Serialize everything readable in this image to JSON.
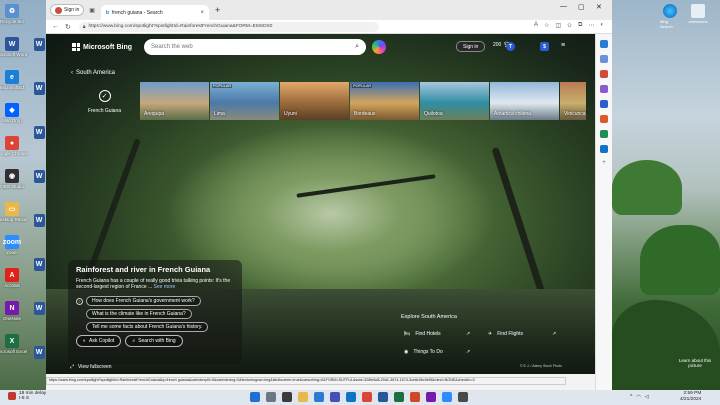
{
  "desktop": {
    "left_icons": [
      {
        "label": "Recycle Bin",
        "icon": "recycle-bin-icon",
        "color": "#5a8fd0",
        "glyph": "♻"
      },
      {
        "label": "Microsoft Word",
        "icon": "word-icon",
        "color": "#2b579a",
        "glyph": "W"
      },
      {
        "label": "MicrosoftEd",
        "icon": "edge-icon",
        "color": "#1b7fd6",
        "glyph": "e"
      },
      {
        "label": "Mac Drop",
        "icon": "dropbox-icon",
        "color": "#0061fe",
        "glyph": "◆"
      },
      {
        "label": "Google Chrome",
        "icon": "chrome-icon",
        "color": "#db4437",
        "glyph": "●"
      },
      {
        "label": "OBS Studio",
        "icon": "obs-icon",
        "color": "#302e31",
        "glyph": "◉"
      },
      {
        "label": "Desktop Recov",
        "icon": "folder-icon",
        "color": "#e8b84a",
        "glyph": "▭"
      },
      {
        "label": "Zoom",
        "icon": "zoom-icon",
        "color": "#2d8cff",
        "glyph": "zoom"
      },
      {
        "label": "Acrobat",
        "icon": "acrobat-icon",
        "color": "#e0231a",
        "glyph": "A"
      },
      {
        "label": "OneNote",
        "icon": "onenote-icon",
        "color": "#7719aa",
        "glyph": "N"
      },
      {
        "label": "Microsoft Excel",
        "icon": "excel-icon",
        "color": "#1d6f42",
        "glyph": "X"
      }
    ],
    "second_col_icons": [
      {
        "label": "",
        "icon": "word-icon",
        "color": "#2b579a",
        "glyph": "W"
      },
      {
        "label": "",
        "icon": "word-icon",
        "color": "#2b579a",
        "glyph": "W"
      },
      {
        "label": "",
        "icon": "word-icon",
        "color": "#2b579a",
        "glyph": "W"
      },
      {
        "label": "",
        "icon": "word-icon",
        "color": "#2b579a",
        "glyph": "W"
      },
      {
        "label": "",
        "icon": "word-icon",
        "color": "#2b579a",
        "glyph": "W"
      },
      {
        "label": "",
        "icon": "word-icon",
        "color": "#2b579a",
        "glyph": "W"
      },
      {
        "label": "",
        "icon": "word-icon",
        "color": "#2b579a",
        "glyph": "W"
      },
      {
        "label": "",
        "icon": "word-icon",
        "color": "#2b579a",
        "glyph": "W"
      }
    ],
    "right_top_icons": [
      {
        "label": "Bing Search",
        "icon": "edge-icon"
      },
      {
        "label": "extensions",
        "icon": "app-icon"
      }
    ],
    "right_note": "Learn about this picture"
  },
  "browser": {
    "profile_label": "Sign in",
    "tab_title": "french guiana - Search",
    "url": "https://www.bing.com/spotlight?spotlightId=RainforestFrenchGuiana&FORM=EMSDS0",
    "status_url": "https://www.bing.com/spotlight?spotlightId=RainforestFrenchGuiana&q=french guiana&carindexpill=0&carindexing=0&textorimgcar=img&isfullscreen=true&carscrlimg=0&FORM=SUTFUL&ssid=328fe6d8-20d1-3674-1574-3ce8c0bc9e5f&mind=NONE&checkfu=0"
  },
  "bing": {
    "brand": "Microsoft Bing",
    "search_placeholder": "Search the web",
    "signin": "Sign in",
    "rewards_count": "200",
    "region_back": "South America",
    "selected_place": "French Guiana",
    "places": [
      {
        "name": "Arequipa",
        "popular": "",
        "colors": [
          "#6f9ccc",
          "#c7a77c",
          "#5b6e4a"
        ]
      },
      {
        "name": "Lima",
        "popular": "POPULAR",
        "colors": [
          "#7ab0d6",
          "#4c79a8",
          "#8a8a7a"
        ]
      },
      {
        "name": "Uyuni",
        "popular": "",
        "colors": [
          "#e3a86a",
          "#9b6b3c",
          "#5a3e25"
        ]
      },
      {
        "name": "Bordeaux",
        "popular": "POPULAR",
        "colors": [
          "#3a6fb5",
          "#d4a55c",
          "#7a5a32"
        ]
      },
      {
        "name": "Quilotoa",
        "popular": "",
        "colors": [
          "#a8c6de",
          "#2f8ea3",
          "#6d7f5a"
        ]
      },
      {
        "name": "Antártica chilena",
        "popular": "",
        "colors": [
          "#93b7d8",
          "#e0e8ee",
          "#6b7c88"
        ]
      },
      {
        "name": "Vinicunca",
        "popular": "",
        "colors": [
          "#b97a52",
          "#c9b06e",
          "#6a5a3c"
        ]
      }
    ],
    "info": {
      "title": "Rainforest and river in French Guiana",
      "body": "French Guiana has a couple of really good trivia talking points: It's the second-largest region of France ...",
      "see_more": "See more",
      "questions": [
        "How does French Guiana's government work?",
        "What is the climate like in French Guiana?",
        "Tell me some facts about French Guiana's history."
      ],
      "ask_copilot": "Ask Copilot",
      "search_bing": "Search with Bing"
    },
    "view_fullscreen": "View fullscreen",
    "explore": {
      "title": "Explore South America",
      "hotels": "Find Hotels",
      "flights": "Find Flights",
      "things": "Things To Do"
    },
    "copyright": "© E.J. / Alamy Stock Photo"
  },
  "taskbar": {
    "weather_temp": "18 min delay",
    "weather_sub": "I-5 S",
    "time": "2:59 PM",
    "date": "4/21/2024"
  },
  "colors": {
    "accent": "#0067b8",
    "taskbar": "#dfe6ed"
  }
}
